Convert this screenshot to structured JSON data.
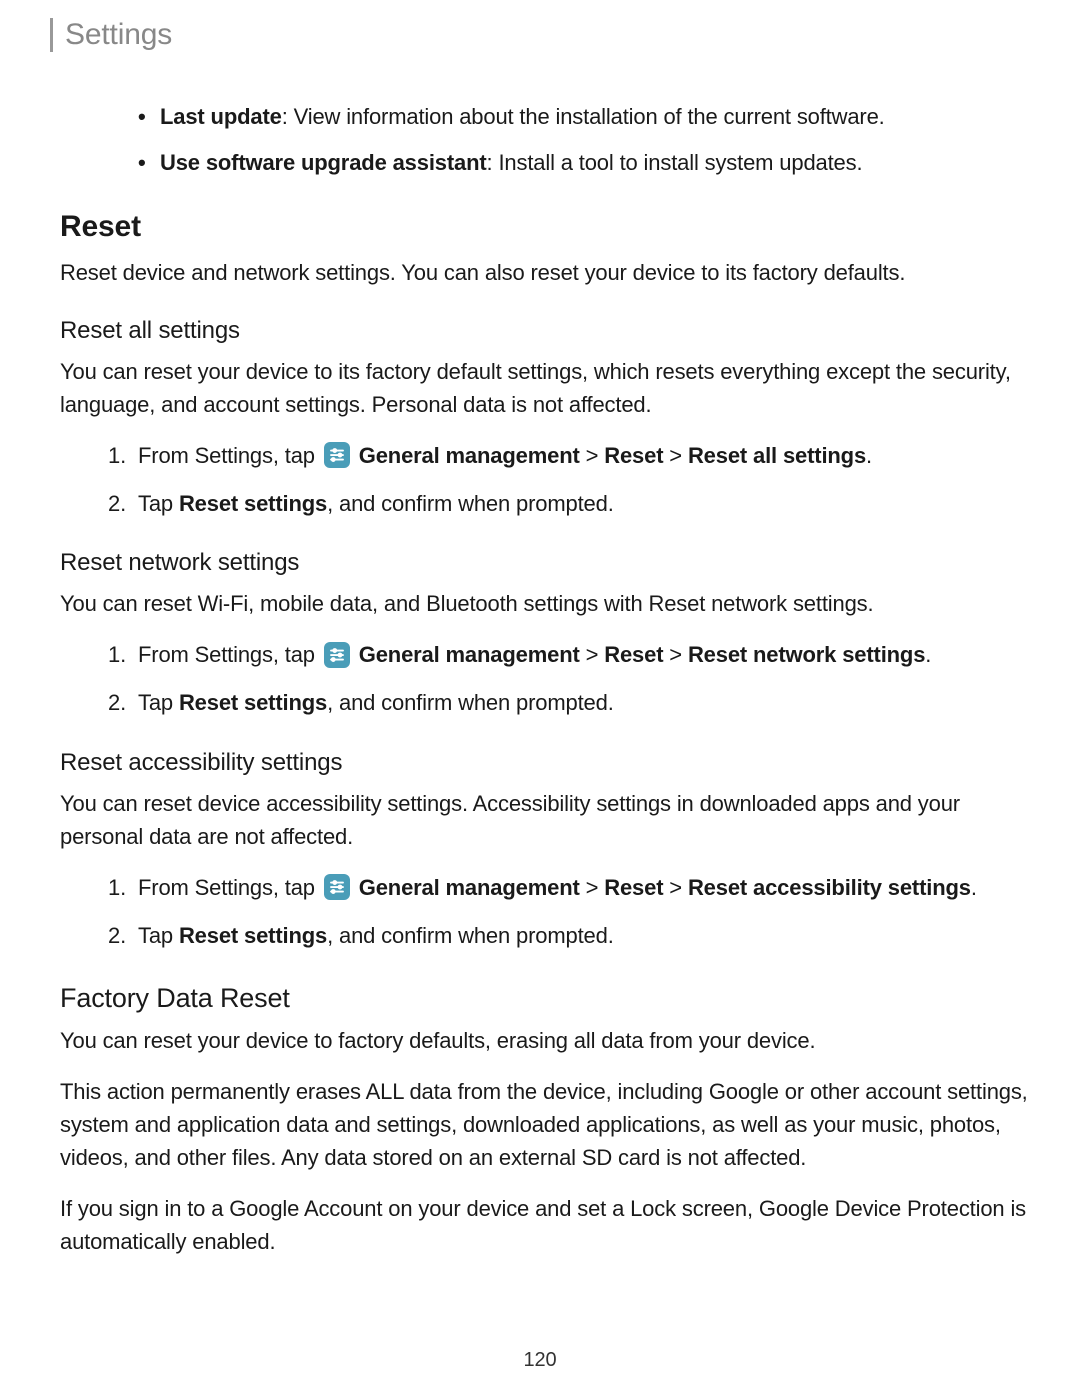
{
  "header": {
    "title": "Settings"
  },
  "bullets": {
    "last_update_label": "Last update",
    "last_update_text": ": View information about the installation of the current software.",
    "upgrade_label": "Use software upgrade assistant",
    "upgrade_text": ": Install a tool to install system updates."
  },
  "reset": {
    "heading": "Reset",
    "intro": "Reset device and network settings. You can also reset your device to its factory defaults."
  },
  "reset_all": {
    "heading": "Reset all settings",
    "intro": "You can reset your device to its factory default settings, which resets everything except the security, language, and account settings. Personal data is not affected.",
    "step1_prefix": "From Settings, tap ",
    "step1_gm": " General management",
    "step1_sep1": " > ",
    "step1_reset": "Reset",
    "step1_sep2": " > ",
    "step1_target": "Reset all settings",
    "step1_end": ".",
    "step2_prefix": "Tap ",
    "step2_bold": "Reset settings",
    "step2_suffix": ", and confirm when prompted."
  },
  "reset_network": {
    "heading": "Reset network settings",
    "intro": "You can reset Wi-Fi, mobile data, and Bluetooth settings with Reset network settings.",
    "step1_prefix": "From Settings, tap ",
    "step1_gm": " General management",
    "step1_sep1": " > ",
    "step1_reset": "Reset",
    "step1_sep2": " > ",
    "step1_target": "Reset network settings",
    "step1_end": ".",
    "step2_prefix": "Tap ",
    "step2_bold": "Reset settings",
    "step2_suffix": ", and confirm when prompted."
  },
  "reset_accessibility": {
    "heading": "Reset accessibility settings",
    "intro": "You can reset device accessibility settings. Accessibility settings in downloaded apps and your personal data are not affected.",
    "step1_prefix": "From Settings, tap ",
    "step1_gm": " General management",
    "step1_sep1": " > ",
    "step1_reset": "Reset",
    "step1_sep2": " > ",
    "step1_target": "Reset accessibility settings",
    "step1_end": ".",
    "step2_prefix": "Tap ",
    "step2_bold": "Reset settings",
    "step2_suffix": ", and confirm when prompted."
  },
  "factory": {
    "heading": "Factory Data Reset",
    "p1": "You can reset your device to factory defaults, erasing all data from your device.",
    "p2": "This action permanently erases ALL data from the device, including Google or other account settings, system and application data and settings, downloaded applications, as well as your music, photos, videos, and other files. Any data stored on an external SD card is not affected.",
    "p3": "If you sign in to a Google Account on your device and set a Lock screen, Google Device Protection is automatically enabled."
  },
  "page_number": "120"
}
